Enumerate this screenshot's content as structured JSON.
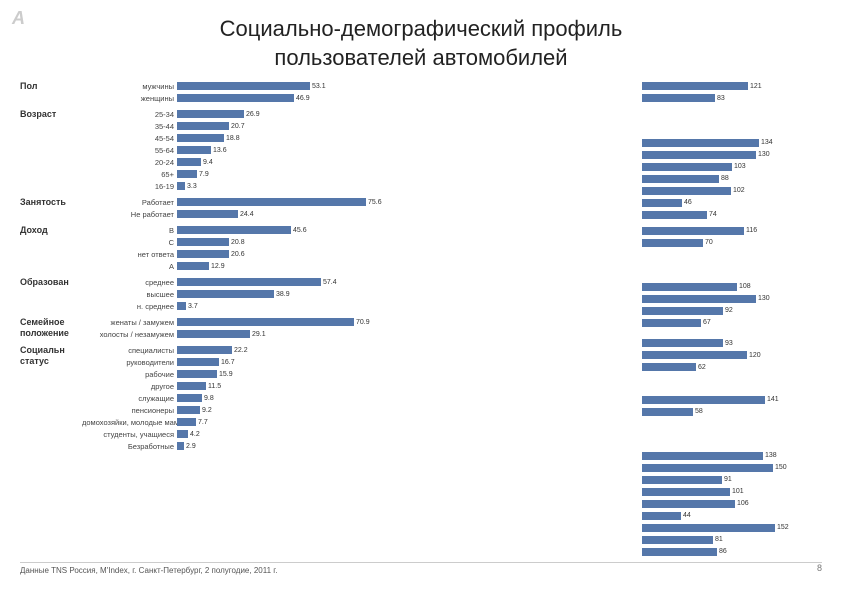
{
  "title": {
    "line1": "Социально-демографический профиль",
    "line2": "пользователей автомобилей"
  },
  "logo": "A",
  "footer": "Данные TNS Россия, M'Index, г. Санкт-Петербург,  2 полугодие, 2011 г.",
  "page_num": "8",
  "groups": [
    {
      "label": "Пол",
      "rows": [
        {
          "cat": "мужчины",
          "val": 53.1,
          "pct": 53.1,
          "rval": 121,
          "rpct": 121
        },
        {
          "cat": "женщины",
          "val": 46.9,
          "pct": 46.9,
          "rval": 83,
          "rpct": 83
        }
      ]
    },
    {
      "label": "Возраст",
      "rows": [
        {
          "cat": "25-34",
          "val": 26.9,
          "pct": 26.9,
          "rval": 134,
          "rpct": 134
        },
        {
          "cat": "35-44",
          "val": 20.7,
          "pct": 20.7,
          "rval": 130,
          "rpct": 130
        },
        {
          "cat": "45-54",
          "val": 18.8,
          "pct": 18.8,
          "rval": 103,
          "rpct": 103
        },
        {
          "cat": "55-64",
          "val": 13.6,
          "pct": 13.6,
          "rval": 88,
          "rpct": 88
        },
        {
          "cat": "20-24",
          "val": 9.4,
          "pct": 9.4,
          "rval": 102,
          "rpct": 102
        },
        {
          "cat": "65+",
          "val": 7.9,
          "pct": 7.9,
          "rval": 46,
          "rpct": 46
        },
        {
          "cat": "16-19",
          "val": 3.3,
          "pct": 3.3,
          "rval": 74,
          "rpct": 74
        }
      ]
    },
    {
      "label": "Занятость",
      "rows": [
        {
          "cat": "Работает",
          "val": 75.6,
          "pct": 75.6,
          "rval": 116,
          "rpct": 116
        },
        {
          "cat": "Не работает",
          "val": 24.4,
          "pct": 24.4,
          "rval": 70,
          "rpct": 70
        }
      ]
    },
    {
      "label": "Доход",
      "rows": [
        {
          "cat": "В",
          "val": 45.6,
          "pct": 45.6,
          "rval": 108,
          "rpct": 108
        },
        {
          "cat": "С",
          "val": 20.8,
          "pct": 20.8,
          "rval": 130,
          "rpct": 130
        },
        {
          "cat": "нет ответа",
          "val": 20.6,
          "pct": 20.6,
          "rval": 92,
          "rpct": 92
        },
        {
          "cat": "А",
          "val": 12.9,
          "pct": 12.9,
          "rval": 67,
          "rpct": 67
        }
      ]
    },
    {
      "label": "Образован",
      "rows": [
        {
          "cat": "среднее",
          "val": 57.4,
          "pct": 57.4,
          "rval": 93,
          "rpct": 93
        },
        {
          "cat": "высшее",
          "val": 38.9,
          "pct": 38.9,
          "rval": 120,
          "rpct": 120
        },
        {
          "cat": "н. среднее",
          "val": 3.7,
          "pct": 3.7,
          "rval": 62,
          "rpct": 62
        }
      ]
    },
    {
      "label": "Семейное\nположение",
      "rows": [
        {
          "cat": "женаты / замужем",
          "val": 70.9,
          "pct": 70.9,
          "rval": 141,
          "rpct": 141
        },
        {
          "cat": "холосты / незамужем",
          "val": 29.1,
          "pct": 29.1,
          "rval": 58,
          "rpct": 58
        }
      ]
    },
    {
      "label": "Социальн\nстатус",
      "rows": [
        {
          "cat": "специалисты",
          "val": 22.2,
          "pct": 22.2,
          "rval": 138,
          "rpct": 138
        },
        {
          "cat": "руководители",
          "val": 16.7,
          "pct": 16.7,
          "rval": 150,
          "rpct": 150
        },
        {
          "cat": "рабочие",
          "val": 15.9,
          "pct": 15.9,
          "rval": 91,
          "rpct": 91
        },
        {
          "cat": "другое",
          "val": 11.5,
          "pct": 11.5,
          "rval": 101,
          "rpct": 101
        },
        {
          "cat": "служащие",
          "val": 9.8,
          "pct": 9.8,
          "rval": 106,
          "rpct": 106
        },
        {
          "cat": "пенсионеры",
          "val": 9.2,
          "pct": 9.2,
          "rval": 44,
          "rpct": 44
        },
        {
          "cat": "домохозяйки, молодые мамы",
          "val": 7.7,
          "pct": 7.7,
          "rval": 152,
          "rpct": 152
        },
        {
          "cat": "студенты, учащиеся",
          "val": 4.2,
          "pct": 4.2,
          "rval": 81,
          "rpct": 81
        },
        {
          "cat": "Безработные",
          "val": 2.9,
          "pct": 2.9,
          "rval": 86,
          "rpct": 86
        }
      ]
    }
  ],
  "chart": {
    "left_max": 80,
    "right_max": 160,
    "left_width": 200,
    "right_width": 140
  }
}
